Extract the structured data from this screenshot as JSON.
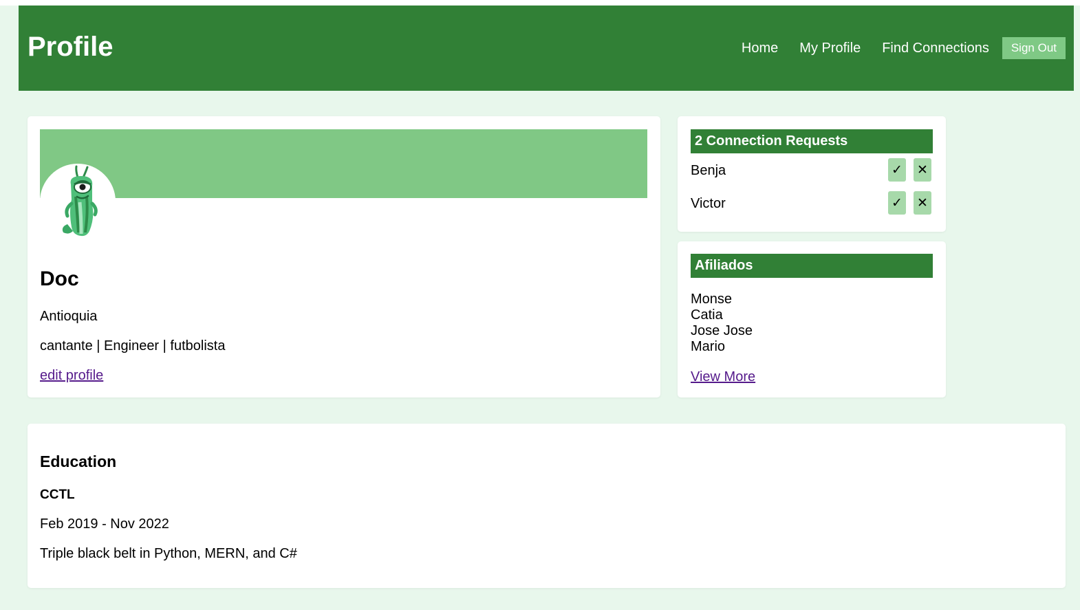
{
  "navbar": {
    "brand": "Profile",
    "links": [
      "Home",
      "My Profile",
      "Find Connections"
    ],
    "signout_label": "Sign Out"
  },
  "profile": {
    "name": "Doc",
    "location": "Antioquia",
    "skills": "cantante | Engineer | futbolista",
    "edit_label": "edit profile"
  },
  "requests": {
    "title": "2 Connection Requests",
    "items": [
      {
        "name": "Benja",
        "accept": "✓",
        "decline": "✕"
      },
      {
        "name": "Victor",
        "accept": "✓",
        "decline": "✕"
      }
    ]
  },
  "affiliates": {
    "title": "Afiliados",
    "items": [
      "Monse",
      "Catia",
      "Jose Jose",
      "Mario"
    ],
    "view_more": "View More"
  },
  "education": {
    "title": "Education",
    "school": "CCTL",
    "dates": "Feb 2019 - Nov 2022",
    "description": "Triple black belt in Python, MERN, and C#"
  },
  "colors": {
    "primary": "#318036",
    "cover": "#80c885",
    "button_light": "#a7d9aa",
    "page_bg": "#e8f7ec",
    "link_visited": "#551a8b"
  },
  "icons": {
    "avatar": "green-alien-slug-character",
    "accept": "check-icon",
    "decline": "close-icon"
  }
}
